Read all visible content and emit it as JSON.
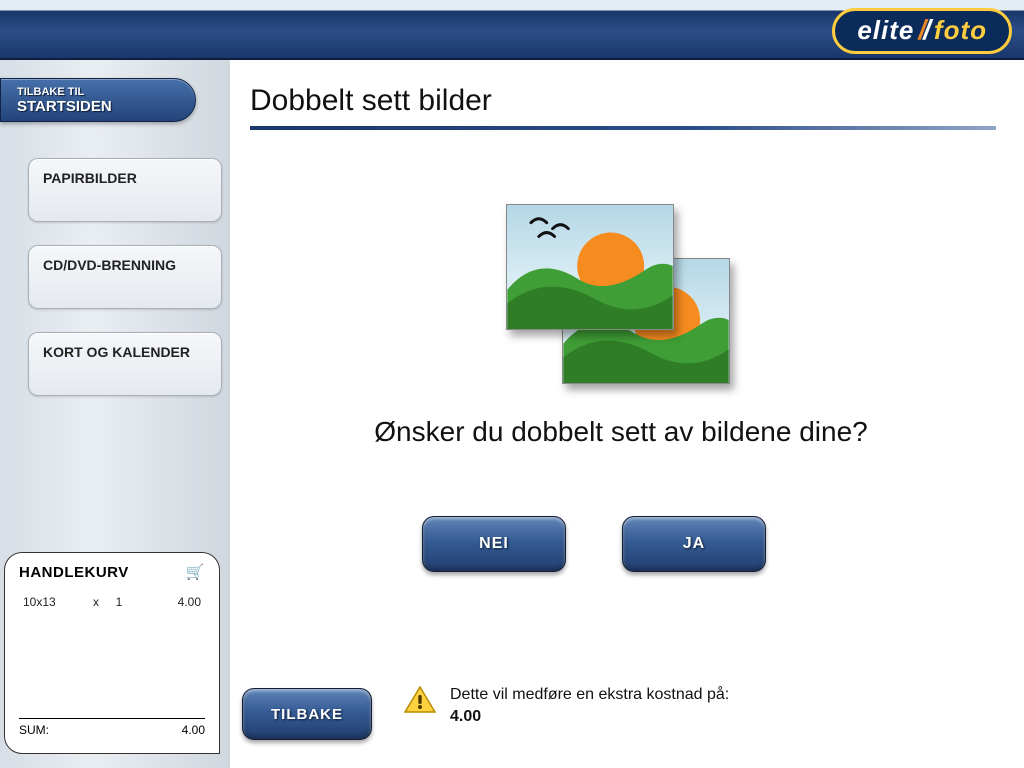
{
  "logo": {
    "left": "elite",
    "right": "foto"
  },
  "home_button": {
    "line1": "TILBAKE TIL",
    "line2": "STARTSIDEN"
  },
  "sidebar": {
    "items": [
      {
        "label": "PAPIRBILDER"
      },
      {
        "label": "CD/DVD-BRENNING"
      },
      {
        "label": "KORT OG KALENDER"
      }
    ]
  },
  "cart": {
    "title": "HANDLEKURV",
    "lines": [
      {
        "product": "10x13",
        "x": "x",
        "qty": "1",
        "price": "4.00"
      }
    ],
    "sum_label": "SUM:",
    "sum_value": "4.00"
  },
  "main": {
    "title": "Dobbelt sett bilder",
    "prompt": "Ønsker du dobbelt sett av bildene dine?",
    "no_label": "NEI",
    "yes_label": "JA",
    "back_label": "TILBAKE",
    "warning_text": "Dette vil medføre en ekstra kostnad på:",
    "warning_amount": "4.00"
  }
}
